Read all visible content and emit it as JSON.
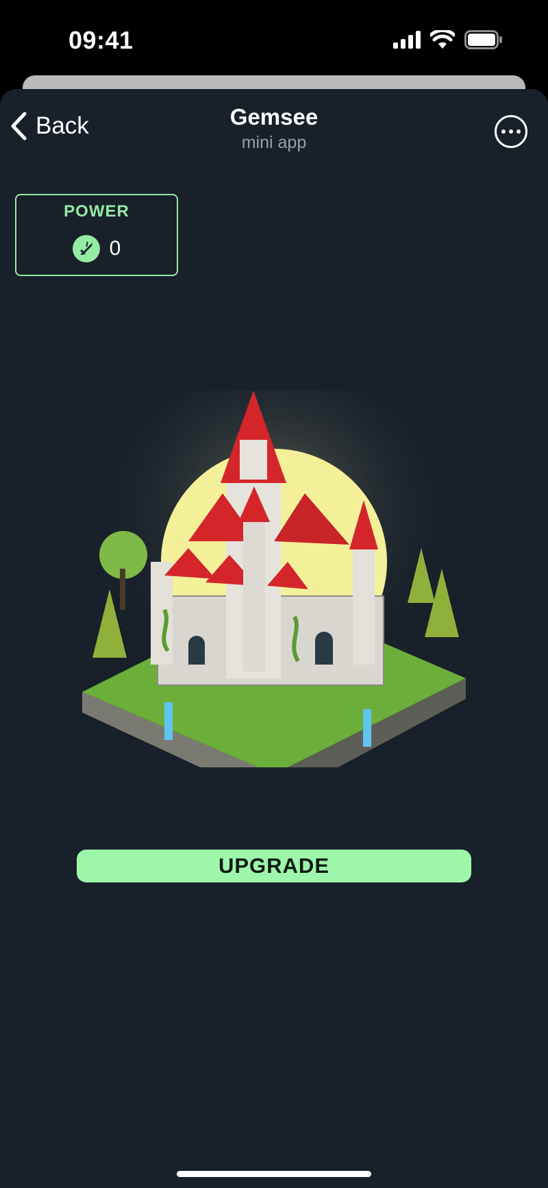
{
  "status_bar": {
    "time": "09:41",
    "icons": [
      "signal-icon",
      "wifi-icon",
      "battery-icon"
    ]
  },
  "header": {
    "back_label": "Back",
    "title": "Gemsee",
    "subtitle": "mini app",
    "more_icon": "more-icon"
  },
  "power": {
    "label": "POWER",
    "value": "0",
    "icon": "power-sword-icon"
  },
  "main": {
    "upgrade_label": "UPGRADE"
  },
  "colors": {
    "background": "#18202a",
    "accent": "#93eba4",
    "button": "#9ef6aa"
  }
}
